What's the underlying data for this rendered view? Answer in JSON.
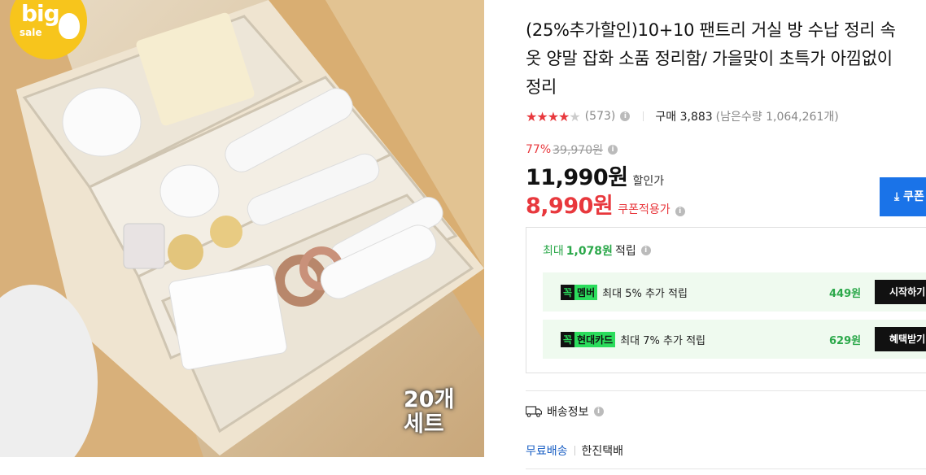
{
  "image": {
    "badge_big": "big",
    "badge_sale": "sale",
    "set_label_line1": "20개",
    "set_label_line2": "세트"
  },
  "product": {
    "title": "(25%추가할인)10+10 팬트리 거실 방 수납 정리 속옷 양말 잡화 소품 정리함/ 가을맞이 초특가 아낌없이 정리",
    "rating_stars": "★★★★",
    "rating_half": "★",
    "review_count": "(573)",
    "purchase_label": "구매 3,883",
    "remaining": "(남은수량 1,064,261개)",
    "discount_rate": "77%",
    "original_price": "39,970원",
    "price": "11,990원",
    "price_label": "할인가",
    "coupon_price": "8,990원",
    "coupon_price_label": "쿠폰적용가",
    "coupon_button": "⤓ 쿠폰"
  },
  "points": {
    "head_prefix": "최대",
    "head_amount": "1,078원",
    "head_suffix": "적립",
    "promos": [
      {
        "logo_a": "꼭",
        "logo_b": "멤버",
        "text": "최대 5% 추가 적립",
        "amount": "449원",
        "button": "시작하기"
      },
      {
        "logo_a": "꼭",
        "logo_b": "현대카드",
        "text": "최대 7% 추가 적립",
        "amount": "629원",
        "button": "혜택받기"
      }
    ]
  },
  "shipping": {
    "label": "배송정보",
    "free": "무료배송",
    "courier": "한진택배"
  },
  "colors": {
    "accent_red": "#e8383d",
    "accent_green": "#2ba84a",
    "button_blue": "#1a73e8"
  }
}
